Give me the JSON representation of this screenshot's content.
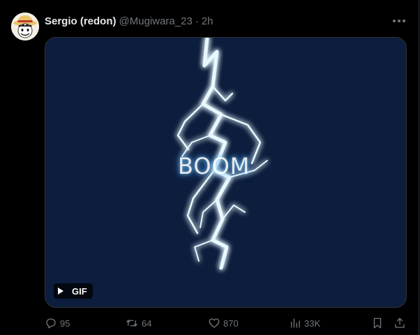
{
  "tweet": {
    "display_name": "Sergio (redon)",
    "handle": "@Mugiwara_23",
    "separator": "·",
    "time": "2h",
    "avatar_icon": "straw-hat-avatar",
    "more_icon": "more-horizontal-icon"
  },
  "media": {
    "type": "gif",
    "gif_text": "BOOM",
    "badge_label": "GIF",
    "background": "#0c1d3d",
    "glow_color": "#7fd3ff"
  },
  "actions": {
    "replies": "95",
    "reposts": "64",
    "likes": "870",
    "views": "33K"
  },
  "colors": {
    "background": "#000000",
    "text_primary": "#e7e9ea",
    "text_secondary": "#71767b",
    "border": "#2f3336"
  }
}
